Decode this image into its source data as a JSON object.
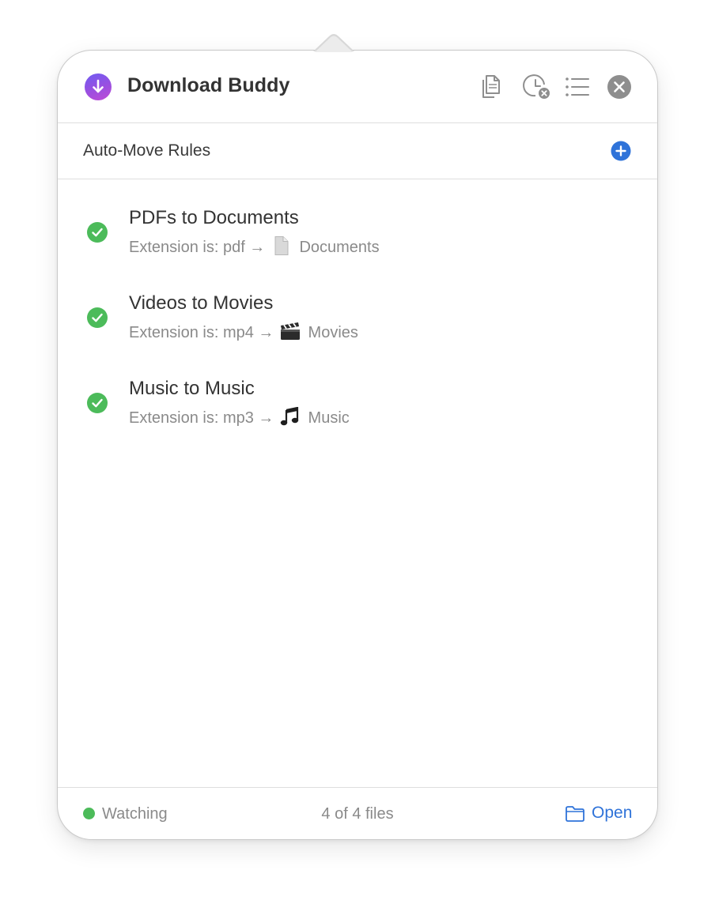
{
  "header": {
    "app_title": "Download Buddy",
    "buttons": [
      {
        "name": "copy-documents-icon",
        "label": ""
      },
      {
        "name": "clear-history-icon",
        "label": ""
      },
      {
        "name": "list-icon",
        "label": ""
      },
      {
        "name": "close-icon",
        "label": ""
      }
    ]
  },
  "section": {
    "title": "Auto-Move Rules",
    "add_icon": "plus-circle-icon"
  },
  "rules": [
    {
      "title": "PDFs to Documents",
      "condition": "Extension is: pdf →",
      "destination_icon": "document-icon",
      "destination": "Documents",
      "enabled": true
    },
    {
      "title": "Videos to Movies",
      "condition": "Extension is: mp4 →",
      "destination_icon": "clapperboard-icon",
      "destination": "Movies",
      "enabled": true
    },
    {
      "title": "Music to Music",
      "condition": "Extension is: mp3 →",
      "destination_icon": "music-note-icon",
      "destination": "Music",
      "enabled": true
    }
  ],
  "footer": {
    "status": "Watching",
    "status_color": "#4cbb5a",
    "file_count": "4 of 4 files",
    "open_label": "Open",
    "open_icon": "folder-icon"
  },
  "colors": {
    "accent_blue": "#2f73d9",
    "check_green": "#4cbb5a",
    "logo_gradient_start": "#6f5cf2",
    "logo_gradient_end": "#c04bd6"
  }
}
